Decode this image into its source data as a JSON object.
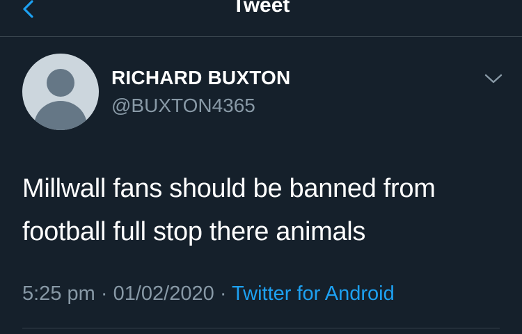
{
  "header": {
    "title": "Tweet",
    "back_icon": "chevron-left-icon",
    "accent_color": "#1da1f2"
  },
  "tweet": {
    "author": {
      "display_name": "RICHARD BUXTON",
      "handle": "@BUXTON4365",
      "avatar": "default-avatar-icon"
    },
    "menu_icon": "chevron-down-icon",
    "text": "Millwall fans should be banned from football full stop there animals",
    "time": "5:25 pm",
    "separator": "·",
    "date": "01/02/2020",
    "source": "Twitter for Android"
  },
  "theme": {
    "background": "#15202b",
    "secondary_text": "#8899a6",
    "link": "#1da1f2",
    "border": "#38444d"
  }
}
